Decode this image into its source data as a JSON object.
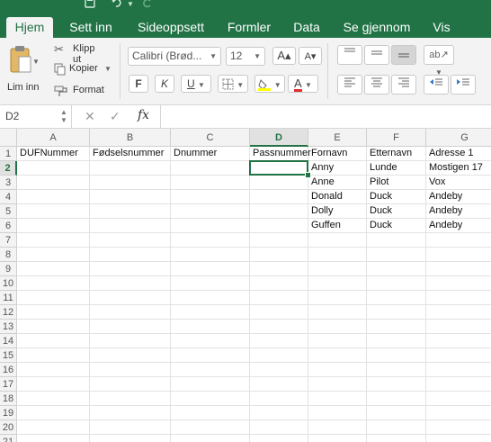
{
  "quick_access": {
    "save_icon": "save-icon",
    "undo_icon": "undo-icon",
    "redo_icon": "redo-icon"
  },
  "tabs": [
    {
      "label": "Hjem",
      "active": true
    },
    {
      "label": "Sett inn",
      "active": false
    },
    {
      "label": "Sideoppsett",
      "active": false
    },
    {
      "label": "Formler",
      "active": false
    },
    {
      "label": "Data",
      "active": false
    },
    {
      "label": "Se gjennom",
      "active": false
    },
    {
      "label": "Vis",
      "active": false
    }
  ],
  "ribbon": {
    "paste_label": "Lim inn",
    "cut_label": "Klipp ut",
    "copy_label": "Kopier",
    "format_label": "Format",
    "font_name": "Calibri (Brød...",
    "font_size": "12",
    "bold": "F",
    "italic": "K",
    "underline": "U",
    "highlight_color": "#ffff00",
    "font_color": "#e03030"
  },
  "formula_bar": {
    "name_box": "D2",
    "fx_label": "fx",
    "formula": ""
  },
  "sheet": {
    "accent_color": "#217346",
    "selected_cell": "D2",
    "columns": [
      "A",
      "B",
      "C",
      "D",
      "E",
      "F",
      "G"
    ],
    "row_numbers": [
      "1",
      "2",
      "3",
      "4",
      "5",
      "6",
      "7",
      "8",
      "9",
      "10",
      "11",
      "12",
      "13",
      "14",
      "15",
      "16",
      "17",
      "18",
      "19",
      "20",
      "21"
    ],
    "rows": [
      [
        "DUFNummer",
        "Fødselsnummer",
        "Dnummer",
        "Passnummer",
        "Fornavn",
        "Etternavn",
        "Adresse 1"
      ],
      [
        "",
        "",
        "",
        "",
        "Anny",
        "Lunde",
        "Mostigen 17"
      ],
      [
        "",
        "",
        "",
        "",
        "Anne",
        "Pilot",
        "Vox"
      ],
      [
        "",
        "",
        "",
        "",
        "Donald",
        "Duck",
        "Andeby"
      ],
      [
        "",
        "",
        "",
        "",
        "Dolly",
        "Duck",
        "Andeby"
      ],
      [
        "",
        "",
        "",
        "",
        "Guffen",
        "Duck",
        "Andeby"
      ]
    ]
  }
}
